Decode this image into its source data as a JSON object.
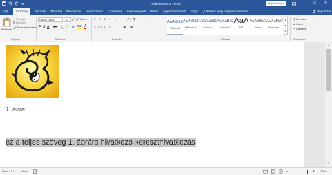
{
  "title_bar": {
    "document_title": "Dokumentum1 - Word",
    "sign_in_label": "Bejelentkezés"
  },
  "tabs": [
    "Fájl",
    "Kezdőlap",
    "Beszúrás",
    "Tervezés",
    "Elrendezés",
    "Hivatkozások",
    "Levelezés",
    "Véleményezés",
    "Nézet",
    "Fejlesztőeszközök",
    "Súgó"
  ],
  "tell_me": "Mukasd meg, hogyan szeretnéd",
  "share_label": "Megosztás",
  "clipboard": {
    "paste_label": "Beillesztés",
    "cut_label": "Kivágás",
    "copy_label": "Másolás",
    "format_painter_label": "Formátummásoló",
    "group_label": "Vágólap"
  },
  "font": {
    "family": "Calibri (Szöv",
    "size": "11",
    "group_label": "Betűtípus"
  },
  "paragraph": {
    "group_label": "Bekezdés"
  },
  "styles": {
    "items": [
      {
        "preview": "AaÁáBbCc",
        "name": "¶ Normál"
      },
      {
        "preview": "AaÁáBbCc",
        "name": "¶ Nincs tá..."
      },
      {
        "preview": "AaÁáBb",
        "name": "Címsor 1"
      },
      {
        "preview": "AaÁáBbC",
        "name": "Címsor 2"
      },
      {
        "preview": "AaA",
        "name": "Cím"
      },
      {
        "preview": "AaÁáBbC",
        "name": "Alcím"
      },
      {
        "preview": "AaÁáBbC",
        "name": "Finom kie..."
      }
    ],
    "group_label": "Stílusok"
  },
  "editing": {
    "find_label": "Keresés",
    "replace_label": "Csere",
    "select_label": "Kijelölés",
    "group_label": "Szerkesztés"
  },
  "document": {
    "caption": "1. ábra",
    "cross_reference": "ez a teljes szöveg 1. ábrára hivatkozó kereszthivatkozás"
  },
  "status": {
    "page": "Oldal 1 / 1",
    "words": "10 szó",
    "zoom": "240%"
  },
  "colors": {
    "accent": "#2b579a",
    "ribbon_bg": "#f3f3f3",
    "highlight": "#c8c8c8",
    "gold": "#f0c020"
  }
}
